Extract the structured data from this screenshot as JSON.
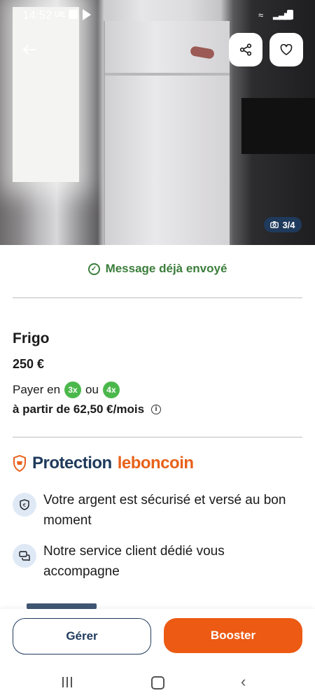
{
  "status_bar": {
    "time": "14:52",
    "carrier": "UE"
  },
  "gallery": {
    "counter": "3/4"
  },
  "notice": {
    "message": "Message déjà envoyé"
  },
  "listing": {
    "title": "Frigo",
    "price": "250 €",
    "pay_prefix": "Payer en",
    "pay_option_1": "3x",
    "pay_separator": "ou",
    "pay_option_2": "4x",
    "monthly": "à partir de 62,50 €/mois"
  },
  "protection": {
    "label_1": "Protection",
    "label_2": "leboncoin",
    "features": [
      {
        "text": "Votre argent est sécurisé et versé au bon moment",
        "icon": "euro-shield-icon"
      },
      {
        "text": "Notre service client dédié vous accompagne",
        "icon": "chat-icon"
      }
    ]
  },
  "actions": {
    "manage": "Gérer",
    "boost": "Booster"
  },
  "colors": {
    "accent": "#ec5a13",
    "brand_blue": "#1f3a5c",
    "success": "#3b7d3b",
    "pill_green": "#4bb84b"
  }
}
